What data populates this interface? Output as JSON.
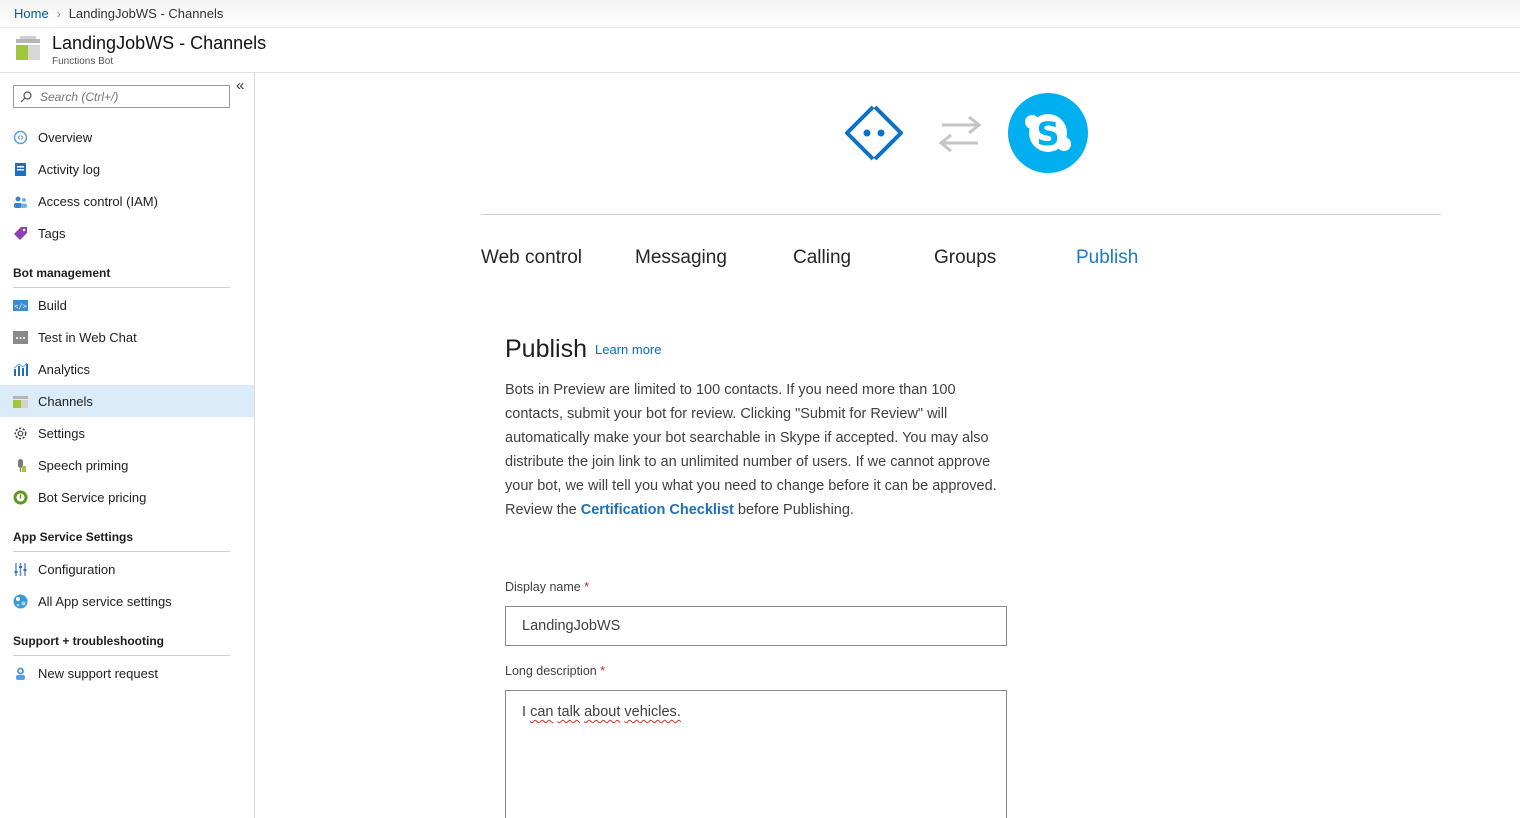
{
  "breadcrumb": {
    "home": "Home",
    "current": "LandingJobWS - Channels"
  },
  "header": {
    "title": "LandingJobWS - Channels",
    "subtitle": "Functions Bot"
  },
  "sidebar": {
    "search_placeholder": "Search (Ctrl+/)",
    "collapse": "«",
    "items": [
      {
        "label": "Overview",
        "icon": "overview-icon"
      },
      {
        "label": "Activity log",
        "icon": "activity-log-icon"
      },
      {
        "label": "Access control (IAM)",
        "icon": "iam-icon"
      },
      {
        "label": "Tags",
        "icon": "tag-icon"
      }
    ],
    "sections": [
      {
        "title": "Bot management",
        "items": [
          {
            "label": "Build",
            "icon": "build-icon"
          },
          {
            "label": "Test in Web Chat",
            "icon": "webchat-icon"
          },
          {
            "label": "Analytics",
            "icon": "analytics-icon"
          },
          {
            "label": "Channels",
            "icon": "channels-icon",
            "active": true
          },
          {
            "label": "Settings",
            "icon": "gear-icon"
          },
          {
            "label": "Speech priming",
            "icon": "microphone-icon"
          },
          {
            "label": "Bot Service pricing",
            "icon": "pricing-icon"
          }
        ]
      },
      {
        "title": "App Service Settings",
        "items": [
          {
            "label": "Configuration",
            "icon": "configuration-icon"
          },
          {
            "label": "All App service settings",
            "icon": "app-service-icon"
          }
        ]
      },
      {
        "title": "Support + troubleshooting",
        "items": [
          {
            "label": "New support request",
            "icon": "support-icon"
          }
        ]
      }
    ]
  },
  "tabs": [
    "Web control",
    "Messaging",
    "Calling",
    "Groups",
    "Publish"
  ],
  "active_tab": "Publish",
  "publish": {
    "title": "Publish",
    "learn_more": "Learn more",
    "description_before": "Bots in Preview are limited to 100 contacts. If you need more than 100 contacts, submit your bot for review. Clicking \"Submit for Review\" will automatically make your bot searchable in Skype if accepted. You may also distribute the join link to an unlimited number of users. If we cannot approve your bot, we will tell you what you need to change before it can be approved. Review the ",
    "checklist_link": "Certification Checklist",
    "description_after": " before Publishing.",
    "display_name_label": "Display name",
    "display_name_value": "LandingJobWS",
    "long_description_label": "Long description",
    "long_description_words": [
      "I",
      "can",
      "talk",
      "about",
      "vehicles."
    ],
    "required_marker": "*"
  },
  "colors": {
    "accent": "#0078d4",
    "skype": "#00aff0",
    "active_nav": "#dcebf8"
  }
}
